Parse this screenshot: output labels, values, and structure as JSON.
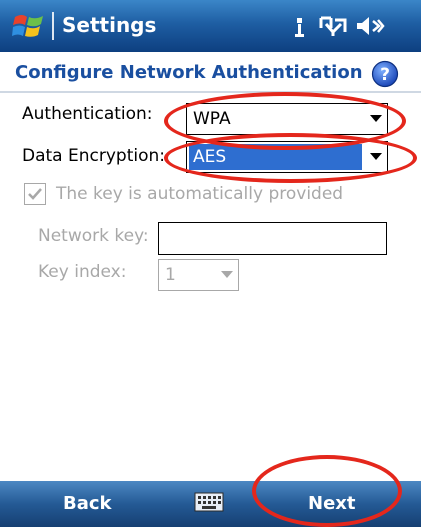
{
  "titlebar": {
    "app_title": "Settings",
    "start_icon": "windows-start-icon",
    "status_icons": [
      "signal-antenna-icon",
      "connectivity-icon",
      "speaker-icon"
    ]
  },
  "header": {
    "title": "Configure Network Authentication",
    "help_icon": "help-icon"
  },
  "form": {
    "authentication": {
      "label": "Authentication:",
      "value": "WPA"
    },
    "data_encryption": {
      "label": "Data Encryption:",
      "value": "AES"
    },
    "auto_key": {
      "label": "The key is automatically provided",
      "checked": true,
      "enabled": false
    },
    "network_key": {
      "label": "Network key:",
      "value": "",
      "enabled": false
    },
    "key_index": {
      "label": "Key index:",
      "value": "1",
      "enabled": false
    }
  },
  "softkeys": {
    "left": "Back",
    "center_icon": "keyboard-icon",
    "right": "Next"
  },
  "colors": {
    "titlebar": "#1e5ea3",
    "header_text": "#1a4fa0",
    "selection": "#2e6ed0",
    "annotation": "#e4271c",
    "disabled_text": "#a8a8a8"
  }
}
